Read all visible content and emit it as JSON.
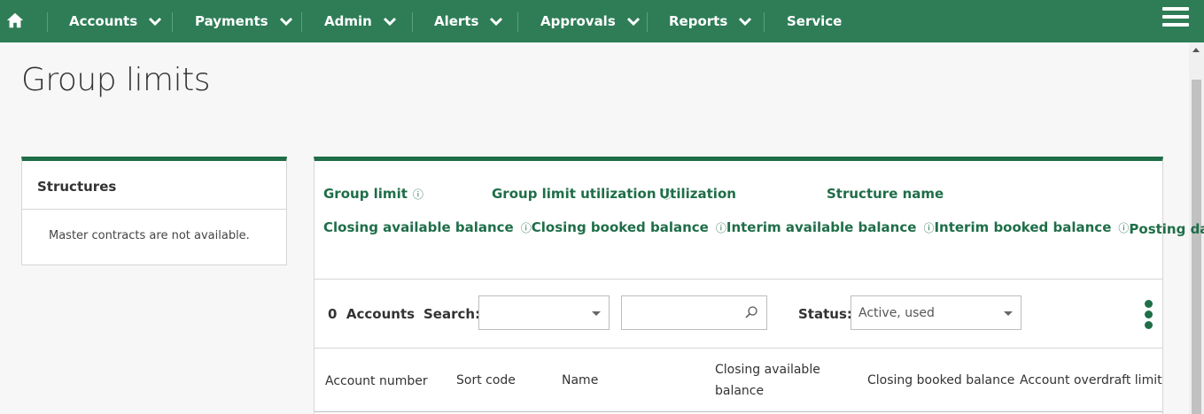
{
  "nav": {
    "items": [
      {
        "label": "Accounts",
        "has_menu": true
      },
      {
        "label": "Payments",
        "has_menu": true
      },
      {
        "label": "Admin",
        "has_menu": true
      },
      {
        "label": "Alerts",
        "has_menu": true
      },
      {
        "label": "Approvals",
        "has_menu": true
      },
      {
        "label": "Reports",
        "has_menu": true
      },
      {
        "label": "Service",
        "has_menu": false
      }
    ],
    "home_icon": "home-icon",
    "menu_icon": "hamburger-menu-icon",
    "color": "#2e7d57"
  },
  "page": {
    "title": "Group limits"
  },
  "structures": {
    "title": "Structures",
    "message": "Master contracts are not available."
  },
  "summary": {
    "group_limit": "Group limit",
    "group_limit_utilization": "Group limit utilization",
    "utilization": "Utilization",
    "structure_name": "Structure name",
    "closing_available_balance": "Closing available balance",
    "closing_booked_balance": "Closing booked balance",
    "interim_available_balance": "Interim available balance",
    "interim_booked_balance": "Interim booked balance",
    "posting_date": "Posting date:",
    "info_icon": "ⓘ"
  },
  "toolbar": {
    "count": "0",
    "accounts_label": "Accounts",
    "search_label": "Search:",
    "search_select_value": "",
    "search_input_value": "",
    "status_label": "Status:",
    "status_value": "Active, used"
  },
  "table": {
    "columns": [
      "Account number",
      "Sort code",
      "Name",
      "Closing available balance",
      "Closing booked balance",
      "Account overdraft limit"
    ]
  },
  "colors": {
    "accent": "#1f6e48",
    "nav": "#2e7d57"
  }
}
